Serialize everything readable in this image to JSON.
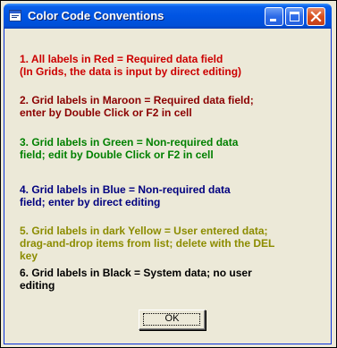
{
  "window": {
    "title": "Color Code Conventions"
  },
  "messages": [
    {
      "text": "1. All labels in Red = Required data field\n(In Grids, the data is input by direct editing)",
      "color": "#cc0000"
    },
    {
      "text": "2. Grid labels in Maroon = Required data field;\nenter by Double Click or F2 in cell",
      "color": "#8b0000"
    },
    {
      "text": "3. Grid labels in Green = Non-required data\nfield; edit by Double Click or F2 in cell",
      "color": "#008000"
    },
    {
      "text": "4. Grid labels in Blue = Non-required data\nfield; enter by direct editing",
      "color": "#00007f"
    },
    {
      "text": "5. Grid labels in dark Yellow = User entered data;\ndrag-and-drop items from list; delete with the DEL\nkey",
      "color": "#8c8c00"
    },
    {
      "text": "6. Grid labels in Black = System data; no user\nediting",
      "color": "#000000"
    }
  ],
  "buttons": {
    "ok_label": "OK"
  },
  "icons": {
    "app": "app-window-icon",
    "minimize": "minimize-icon",
    "maximize": "maximize-icon",
    "close": "close-icon"
  },
  "colors": {
    "titlebar": "#0054e3",
    "dialog_background": "#ece9d8",
    "close_button": "#d8501e"
  }
}
